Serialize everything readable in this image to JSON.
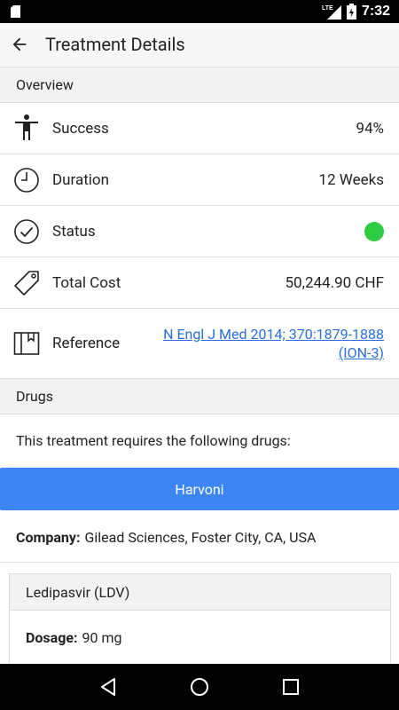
{
  "status_bar": {
    "network": "LTE",
    "time": "7:32"
  },
  "app_bar": {
    "title": "Treatment Details"
  },
  "overview": {
    "header": "Overview",
    "rows": [
      {
        "icon": "person-icon",
        "label": "Success",
        "value": "94%"
      },
      {
        "icon": "clock-icon",
        "label": "Duration",
        "value": "12 Weeks"
      },
      {
        "icon": "check-circle-icon",
        "label": "Status",
        "status_color": "#2ecc40"
      },
      {
        "icon": "price-tag-icon",
        "label": "Total Cost",
        "value": "50,244.90 CHF"
      },
      {
        "icon": "book-icon",
        "label": "Reference",
        "link_line1": "N Engl J Med 2014; 370:1879-1888",
        "link_line2": "(ION-3)"
      }
    ]
  },
  "drugs": {
    "header": "Drugs",
    "intro": "This treatment requires the following drugs:",
    "drug_name": "Harvoni",
    "company_label": "Company:",
    "company_value": "Gilead Sciences, Foster City, CA, USA",
    "ingredient": {
      "name": "Ledipasvir (LDV)",
      "dosage_label": "Dosage:",
      "dosage_value": "90 mg"
    }
  },
  "colors": {
    "accent": "#3b86f4",
    "link": "#2a6fd6",
    "status_ok": "#2ecc40"
  }
}
